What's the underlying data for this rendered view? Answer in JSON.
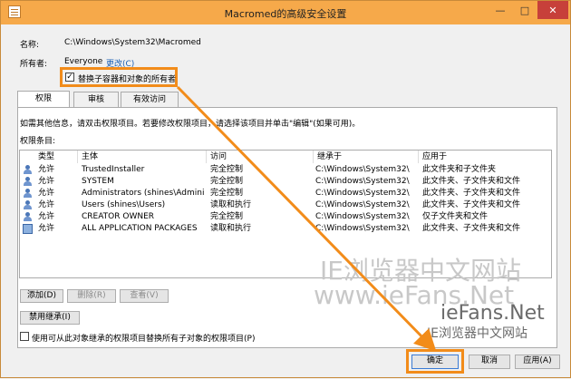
{
  "window": {
    "title": "Macromed的高级安全设置",
    "min": "—",
    "max": "□",
    "close": "✕"
  },
  "info": {
    "name_label": "名称:",
    "name_value": "C:\\Windows\\System32\\Macromed",
    "owner_label": "所有者:",
    "owner_value": "Everyone",
    "owner_change": "更改(C)",
    "replace_owner_label": "替换子容器和对象的所有者",
    "replace_owner_checked": "✓"
  },
  "tabs": [
    {
      "label": "权限"
    },
    {
      "label": "审核"
    },
    {
      "label": "有效访问"
    }
  ],
  "panel": {
    "hint": "如需其他信息，请双击权限项目。若要修改权限项目，请选择该项目并单击\"编辑\"(如果可用)。",
    "entries_label": "权限条目:"
  },
  "table": {
    "headers": [
      "类型",
      "主体",
      "访问",
      "继承于",
      "应用于"
    ],
    "rows": [
      {
        "type": "允许",
        "principal": "TrustedInstaller",
        "access": "完全控制",
        "inherited": "C:\\Windows\\System32\\",
        "applies": "此文件夹和子文件夹"
      },
      {
        "type": "允许",
        "principal": "SYSTEM",
        "access": "完全控制",
        "inherited": "C:\\Windows\\System32\\",
        "applies": "此文件夹、子文件夹和文件"
      },
      {
        "type": "允许",
        "principal": "Administrators (shines\\Administr...",
        "access": "完全控制",
        "inherited": "C:\\Windows\\System32\\",
        "applies": "此文件夹、子文件夹和文件"
      },
      {
        "type": "允许",
        "principal": "Users (shines\\Users)",
        "access": "读取和执行",
        "inherited": "C:\\Windows\\System32\\",
        "applies": "此文件夹、子文件夹和文件"
      },
      {
        "type": "允许",
        "principal": "CREATOR OWNER",
        "access": "完全控制",
        "inherited": "C:\\Windows\\System32\\",
        "applies": "仅子文件夹和文件"
      },
      {
        "type": "允许",
        "principal": "ALL APPLICATION PACKAGES",
        "access": "读取和执行",
        "inherited": "C:\\Windows\\System32\\",
        "applies": "此文件夹、子文件夹和文件"
      }
    ]
  },
  "buttons": {
    "add": "添加(D)",
    "remove": "删除(R)",
    "view": "查看(V)",
    "disable_inheritance": "禁用继承(I)",
    "replace_all_label": "使用可从此对象继承的权限项目替换所有子对象的权限项目(P)",
    "ok": "确定",
    "cancel": "取消",
    "apply": "应用(A)"
  },
  "watermark": {
    "line1": "IE浏览器中文网站",
    "line2": "www.ieFans.Net",
    "line3": "ieFans.Net",
    "line4": "IE浏览器中文网站"
  },
  "colors": {
    "accent": "#f28c1a",
    "titlebar": "#f6a94a",
    "close": "#c7403a",
    "link": "#1a5fb4"
  }
}
